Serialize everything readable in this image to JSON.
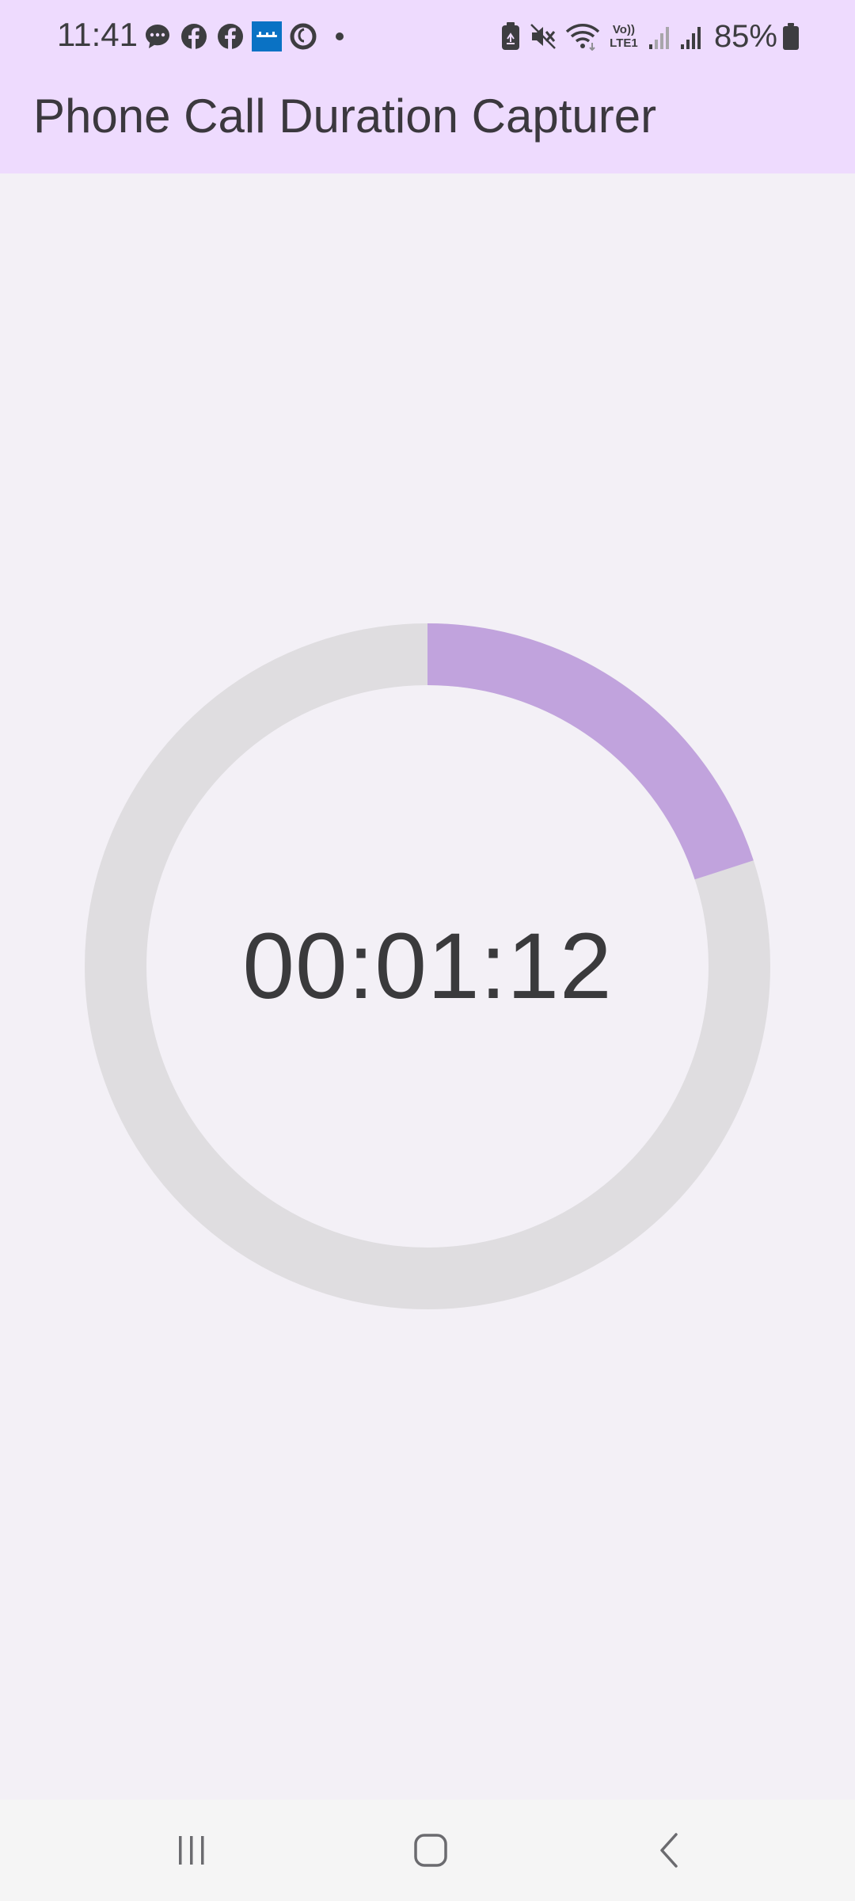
{
  "status_bar": {
    "time": "11:41",
    "left_icons": [
      "messages-icon",
      "facebook-icon",
      "facebook-icon",
      "banking-app-icon",
      "vodafone-icon",
      "dot-icon"
    ],
    "right_icons": [
      "battery-saver-icon",
      "mute-icon",
      "wifi-icon",
      "volte-icon",
      "signal-weak-icon",
      "signal-icon",
      "battery-icon"
    ],
    "volte_label_top": "Vo))",
    "volte_label_bottom": "LTE1",
    "battery": "85%"
  },
  "app_bar": {
    "title": "Phone Call Duration Capturer"
  },
  "timer": {
    "display": "00:01:12",
    "progress": 0.2,
    "progress_color": "#c1a3dd",
    "track_color": "#dfdde0"
  },
  "nav_bar": {
    "buttons": [
      "recent-apps-icon",
      "home-icon",
      "back-icon"
    ]
  },
  "colors": {
    "app_bar_bg": "#eedbfe",
    "page_bg": "#f3f0f6"
  }
}
